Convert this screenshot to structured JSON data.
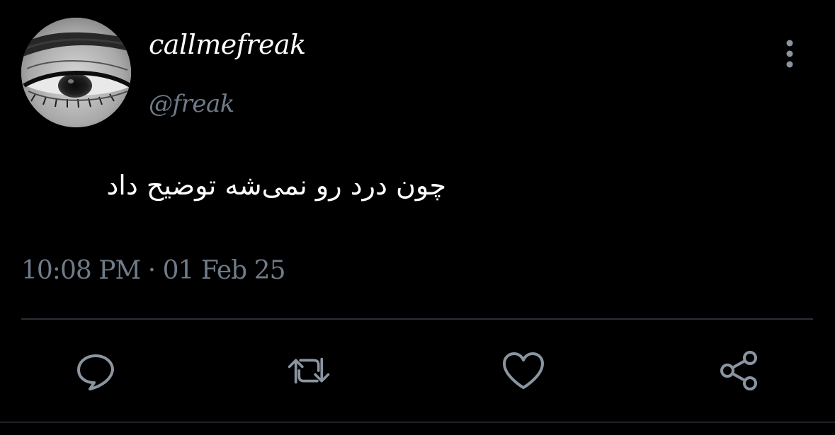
{
  "user": {
    "display_name": "callmefreak",
    "handle": "@freak"
  },
  "tweet": {
    "text": "چون درد رو نمی‌شه توضیح داد",
    "timestamp": "10:08 PM · 01 Feb 25"
  },
  "actions": [
    {
      "icon": "reply-icon"
    },
    {
      "icon": "retweet-icon"
    },
    {
      "icon": "like-icon"
    },
    {
      "icon": "share-icon"
    }
  ],
  "colors": {
    "background": "#000000",
    "primary_text": "#ffffff",
    "secondary_text": "#6f7b88",
    "divider": "#2b3037"
  }
}
